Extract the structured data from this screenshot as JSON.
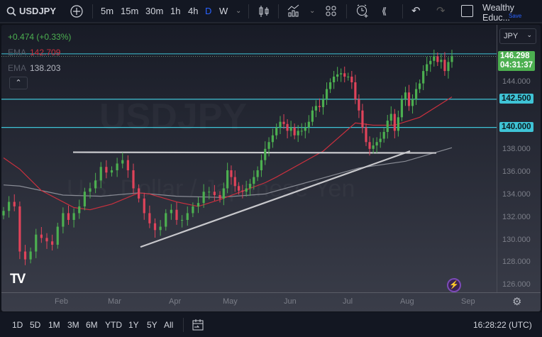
{
  "toolbar": {
    "symbol": "USDJPY",
    "intervals": [
      "5m",
      "15m",
      "30m",
      "1h",
      "4h",
      "D",
      "W"
    ],
    "active_interval": "D",
    "account": "Wealthy Educ...",
    "save": "Save"
  },
  "legend": {
    "change": "+0.474 (+0.33%)",
    "ema1_label": "EMA",
    "ema1_value": "142.709",
    "ema2_label": "EMA",
    "ema2_value": "138.203"
  },
  "currency": "JPY",
  "watermark": {
    "symbol": "USDJPY",
    "description": "U.S. Dollar / Japanese Yen"
  },
  "colors": {
    "up": "#4caf50",
    "down": "#e0435a",
    "ema_fast": "#c9303e",
    "ema_slow": "#8a8d96",
    "hline": "#3fc3d6",
    "accent": "#2962ff"
  },
  "chart_data": {
    "type": "candlestick",
    "symbol": "USDJPY",
    "interval": "D",
    "closes": [
      132.6,
      133.4,
      133.0,
      129.0,
      128.3,
      129.0,
      130.5,
      130.2,
      129.9,
      129.6,
      131.2,
      132.4,
      131.8,
      132.4,
      133.0,
      134.3,
      134.6,
      135.3,
      136.5,
      136.0,
      136.2,
      136.8,
      137.1,
      136.2,
      134.6,
      133.7,
      132.4,
      131.5,
      130.9,
      131.2,
      132.4,
      132.7,
      131.8,
      131.8,
      132.4,
      133.0,
      133.3,
      134.3,
      134.3,
      134.0,
      133.7,
      134.6,
      136.2,
      135.6,
      134.8,
      134.4,
      134.3,
      134.6,
      135.0,
      135.6,
      136.2,
      137.1,
      138.1,
      138.7,
      139.3,
      140.0,
      140.5,
      140.3,
      139.7,
      140.0,
      139.3,
      139.7,
      139.7,
      140.0,
      140.5,
      141.5,
      141.9,
      141.8,
      142.5,
      143.4,
      144.0,
      144.5,
      144.7,
      144.8,
      144.5,
      144.5,
      144.0,
      142.5,
      141.5,
      140.0,
      138.7,
      138.1,
      138.4,
      138.7,
      139.0,
      139.6,
      140.6,
      141.2,
      139.7,
      140.9,
      142.5,
      143.1,
      141.9,
      142.5,
      143.4,
      143.9,
      145.0,
      145.6,
      145.9,
      146.3,
      145.8,
      146.0,
      145.0,
      145.8,
      146.298
    ],
    "ema_fast": [
      [
        0,
        137.3
      ],
      [
        3,
        136.3
      ],
      [
        7,
        134.4
      ],
      [
        13,
        132.9
      ],
      [
        16,
        132.7
      ],
      [
        20,
        133.2
      ],
      [
        25,
        134.2
      ],
      [
        27,
        134.1
      ],
      [
        32,
        133.4
      ],
      [
        36,
        133.0
      ],
      [
        40,
        133.6
      ],
      [
        44,
        134.1
      ],
      [
        52,
        135.1
      ],
      [
        55,
        135.6
      ],
      [
        68,
        137.9
      ],
      [
        77,
        140.4
      ],
      [
        82,
        140.2
      ],
      [
        88,
        140.2
      ],
      [
        95,
        140.9
      ],
      [
        104,
        142.7
      ]
    ],
    "ema_slow": [
      [
        0,
        134.9
      ],
      [
        3,
        134.8
      ],
      [
        11,
        134.0
      ],
      [
        18,
        133.9
      ],
      [
        25,
        134.2
      ],
      [
        32,
        133.9
      ],
      [
        40,
        133.8
      ],
      [
        52,
        134.1
      ],
      [
        78,
        136.4
      ],
      [
        91,
        137.0
      ],
      [
        104,
        138.2
      ]
    ],
    "horizontal_levels": [
      142.5,
      140.0
    ],
    "current_price": "146.298",
    "countdown": "04:31:37",
    "support_line": 137.8,
    "trendline": [
      129.4,
      137.9
    ],
    "y_ticks": [
      "144.000",
      "138.000",
      "136.000",
      "134.000",
      "132.000",
      "130.000",
      "128.000",
      "126.000"
    ],
    "level_labels": [
      "142.500",
      "140.000"
    ],
    "x_ticks": [
      "Feb",
      "Mar",
      "Apr",
      "May",
      "Jun",
      "Jul",
      "Aug",
      "Sep"
    ],
    "ylim": [
      125.2,
      149
    ]
  },
  "bottom": {
    "ranges": [
      "1D",
      "5D",
      "1M",
      "3M",
      "6M",
      "YTD",
      "1Y",
      "5Y",
      "All"
    ],
    "clock": "16:28:22 (UTC)"
  }
}
